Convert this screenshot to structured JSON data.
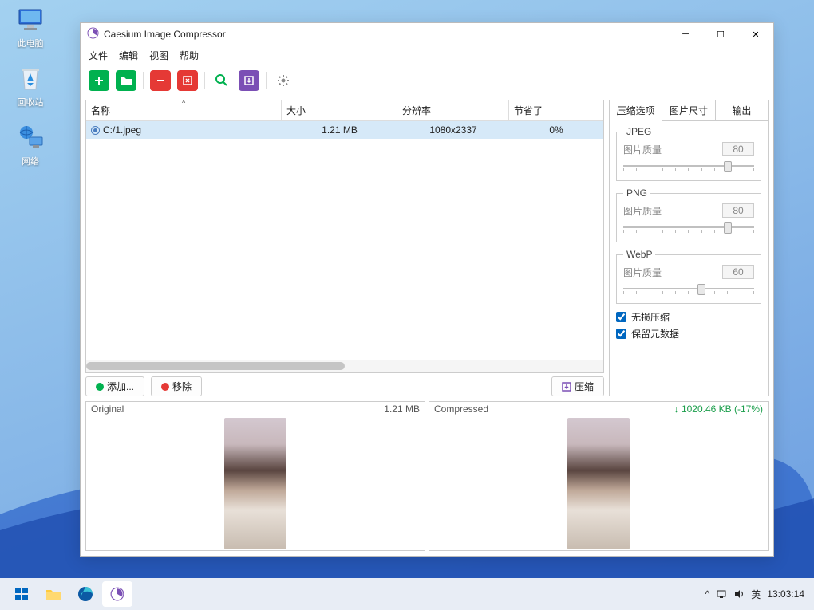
{
  "desktop": {
    "icons": [
      {
        "label": "此电脑",
        "name": "this-pc"
      },
      {
        "label": "回收站",
        "name": "recycle-bin"
      },
      {
        "label": "网络",
        "name": "network"
      }
    ]
  },
  "taskbar": {
    "ime": "英",
    "time": "13:03:14"
  },
  "window": {
    "title": "Caesium Image Compressor",
    "menus": {
      "file": "文件",
      "edit": "编辑",
      "view": "视图",
      "help": "帮助"
    }
  },
  "table": {
    "headers": {
      "name": "名称",
      "size": "大小",
      "resolution": "分辨率",
      "saved": "节省了"
    },
    "row": {
      "file": "C:/1.jpeg",
      "size": "1.21 MB",
      "resolution": "1080x2337",
      "saved": "0%"
    }
  },
  "actions": {
    "add": "添加...",
    "remove": "移除",
    "compress": "压缩"
  },
  "panel": {
    "tabs": {
      "compress": "压缩选项",
      "size": "图片尺寸",
      "output": "输出"
    },
    "jpeg": {
      "legend": "JPEG",
      "label": "图片质量",
      "value": "80",
      "pos": 80
    },
    "png": {
      "legend": "PNG",
      "label": "图片质量",
      "value": "80",
      "pos": 80
    },
    "webp": {
      "legend": "WebP",
      "label": "图片质量",
      "value": "60",
      "pos": 60
    },
    "lossless": "无损压缩",
    "keep_meta": "保留元数据"
  },
  "preview": {
    "original": {
      "label": "Original",
      "size": "1.21 MB"
    },
    "compressed": {
      "label": "Compressed",
      "size": "1020.46 KB (-17%)"
    }
  }
}
